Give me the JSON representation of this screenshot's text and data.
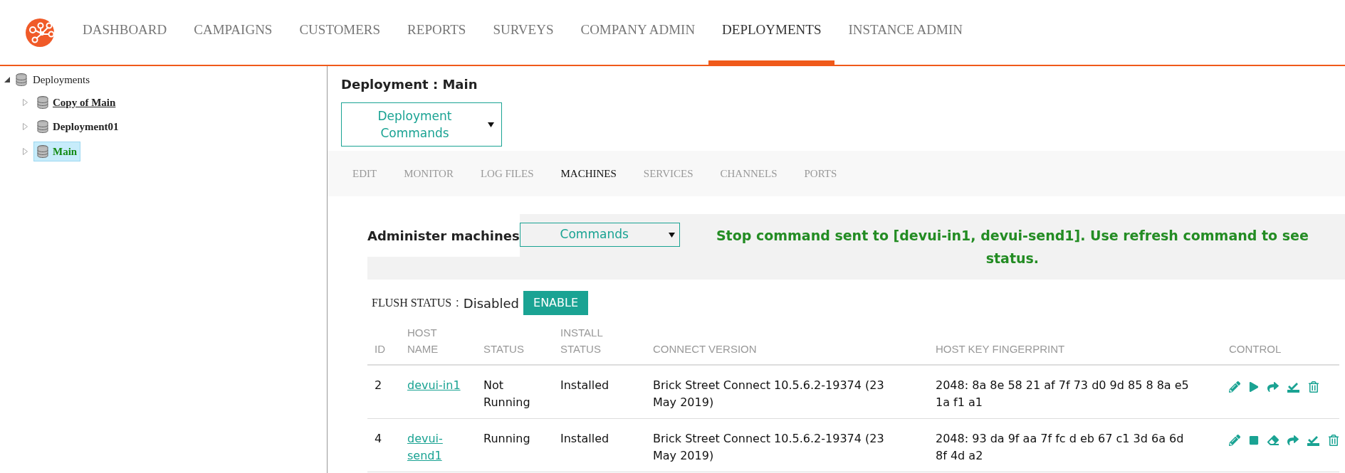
{
  "nav": {
    "items": [
      {
        "label": "DASHBOARD",
        "selected": false
      },
      {
        "label": "CAMPAIGNS",
        "selected": false
      },
      {
        "label": "CUSTOMERS",
        "selected": false
      },
      {
        "label": "REPORTS",
        "selected": false
      },
      {
        "label": "SURVEYS",
        "selected": false
      },
      {
        "label": "COMPANY ADMIN",
        "selected": false
      },
      {
        "label": "DEPLOYMENTS",
        "selected": true
      },
      {
        "label": "INSTANCE ADMIN",
        "selected": false
      }
    ]
  },
  "tree": {
    "label": "Deployments",
    "expanded": true,
    "children": [
      {
        "label": "Copy of Main",
        "selected": false,
        "underlined": true
      },
      {
        "label": "Deployment01",
        "selected": false,
        "underlined": false
      },
      {
        "label": "Main",
        "selected": true,
        "underlined": false
      }
    ]
  },
  "content": {
    "title": "Deployment : Main",
    "commands_dropdown": "Deployment Commands",
    "tabs": [
      {
        "label": "EDIT",
        "selected": false
      },
      {
        "label": "MONITOR",
        "selected": false
      },
      {
        "label": "LOG FILES",
        "selected": false
      },
      {
        "label": "MACHINES",
        "selected": true
      },
      {
        "label": "SERVICES",
        "selected": false
      },
      {
        "label": "CHANNELS",
        "selected": false
      },
      {
        "label": "PORTS",
        "selected": false
      }
    ],
    "admin_label": "Administer machines",
    "admin_dropdown": "Commands",
    "message": "Stop command sent to [devui-in1, devui-send1]. Use refresh command to see status.",
    "flush_label": "FLUSH STATUS",
    "flush_sep": ":",
    "flush_value": "Disabled",
    "enable_button": "ENABLE",
    "table": {
      "columns": [
        "ID",
        "HOST NAME",
        "STATUS",
        "INSTALL STATUS",
        "CONNECT VERSION",
        "HOST KEY FINGERPRINT",
        "CONTROL"
      ],
      "rows": [
        {
          "id": "2",
          "host": "devui-in1",
          "status": "Not Running",
          "install": "Installed",
          "version": "Brick Street Connect 10.5.6.2-19374 (23 May 2019)",
          "fingerprint": "2048: 8a 8e 58 21 af 7f 73 d0 9d 85 8 8a e5 1a f1 a1",
          "controls": [
            {
              "kind": "edit"
            },
            {
              "kind": "start"
            },
            {
              "kind": "deploy"
            },
            {
              "kind": "install"
            },
            {
              "kind": "delete"
            }
          ]
        },
        {
          "id": "4",
          "host": "devui-send1",
          "status": "Running",
          "install": "Installed",
          "version": "Brick Street Connect 10.5.6.2-19374 (23 May 2019)",
          "fingerprint": "2048: 93 da 9f aa 7f fc d eb 67 c1 3d 6a 6d 8f 4d a2",
          "controls": [
            {
              "kind": "edit"
            },
            {
              "kind": "stop"
            },
            {
              "kind": "clear"
            },
            {
              "kind": "deploy"
            },
            {
              "kind": "install"
            },
            {
              "kind": "delete"
            }
          ]
        }
      ]
    }
  }
}
